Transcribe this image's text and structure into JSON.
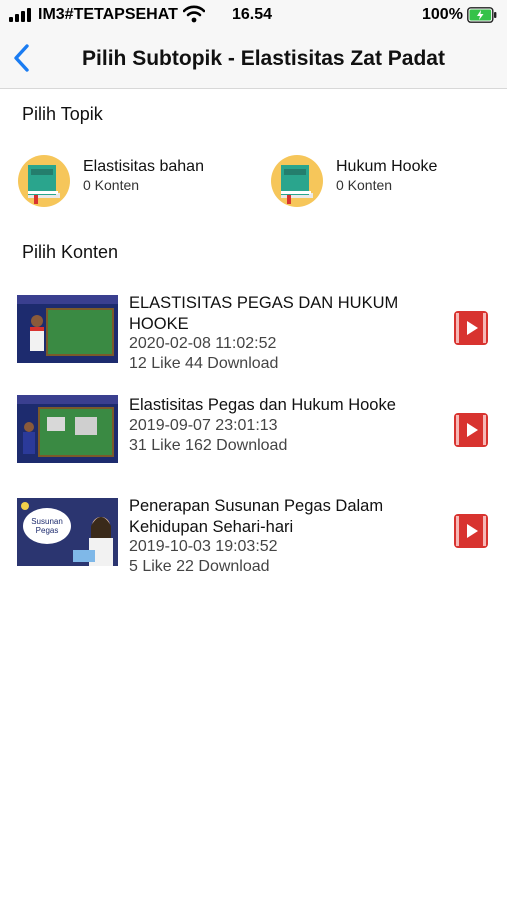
{
  "status_bar": {
    "carrier": "IM3#TETAPSEHAT",
    "time": "16.54",
    "battery": "100%"
  },
  "header": {
    "title": "Pilih Subtopik - Elastisitas Zat Padat"
  },
  "topics_section": {
    "heading": "Pilih Topik"
  },
  "topics": [
    {
      "name": "Elastisitas bahan",
      "count": "0 Konten"
    },
    {
      "name": "Hukum Hooke",
      "count": "0 Konten"
    }
  ],
  "content_section": {
    "heading": "Pilih Konten"
  },
  "contents": [
    {
      "title": "ELASTISITAS PEGAS DAN HUKUM HOOKE",
      "date": "2020-02-08 11:02:52",
      "stats": "12 Like 44 Download"
    },
    {
      "title": "Elastisitas Pegas dan Hukum Hooke",
      "date": "2019-09-07 23:01:13",
      "stats": "31 Like 162 Download"
    },
    {
      "title": "Penerapan Susunan Pegas Dalam Kehidupan Sehari-hari",
      "date": "2019-10-03 19:03:52",
      "stats": "5 Like 22 Download",
      "thumb_bubble": "Susunan Pegas"
    }
  ],
  "colors": {
    "accent": "#1a7cf2",
    "video_icon": "#d8332f",
    "topic_circle": "#f6c65a",
    "chalkboard": "#3a8a43"
  },
  "icons": {
    "back": "chevron-left-icon",
    "topic": "book-icon",
    "content": "video-play-icon"
  }
}
